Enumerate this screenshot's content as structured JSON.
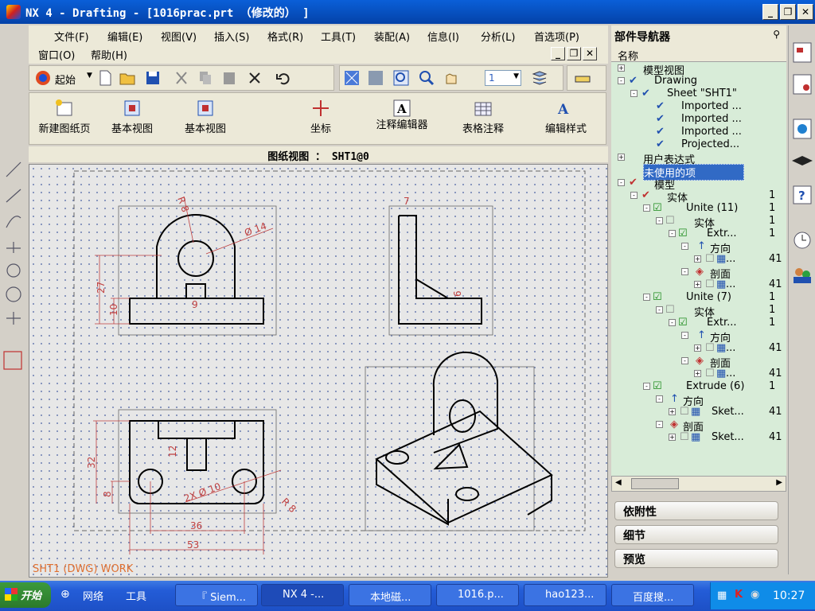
{
  "window": {
    "title": "NX 4 - Drafting - [1016prac.prt （修改的） ]"
  },
  "menubar": {
    "row1": [
      "文件(F)",
      "编辑(E)",
      "视图(V)",
      "插入(S)",
      "格式(R)",
      "工具(T)",
      "装配(A)",
      "信息(I)",
      "分析(L)",
      "首选项(P)"
    ],
    "row2": [
      "窗口(O)",
      "帮助(H)"
    ]
  },
  "toolbar": {
    "start_label": "起始",
    "layer_value": "1"
  },
  "drafting_toolbar": {
    "buttons": [
      "新建图纸页",
      "基本视图",
      "基本视图",
      "坐标",
      "注释编辑器",
      "表格注释",
      "编辑样式"
    ]
  },
  "canvas": {
    "view_label": "图纸视图 ： SHT1@0",
    "status": "SHT1 (DWG) WORK",
    "dims": {
      "r8": "R 8",
      "phi14": "Ø 14",
      "d27": "27",
      "d10": "10",
      "d9": "9",
      "d7": "7",
      "d6": "6",
      "d32": "32",
      "d8": "8",
      "d12": "12",
      "phi10": "2X Ø 10",
      "r8b": "R 8",
      "d36": "36",
      "d53": "53"
    }
  },
  "navigator": {
    "title": "部件导航器",
    "column_name": "名称",
    "tree": [
      {
        "label": "模型视图",
        "val": ""
      },
      {
        "label": "Drawing",
        "val": ""
      },
      {
        "label": "Sheet \"SHT1\"",
        "val": ""
      },
      {
        "label": "Imported ...",
        "val": ""
      },
      {
        "label": "Imported ...",
        "val": ""
      },
      {
        "label": "Imported ...",
        "val": ""
      },
      {
        "label": "Projected...",
        "val": ""
      },
      {
        "label": "用户表达式",
        "val": ""
      },
      {
        "label": "未使用的项",
        "val": ""
      },
      {
        "label": "模型",
        "val": ""
      },
      {
        "label": "实体",
        "val": "1"
      },
      {
        "label": "Unite (11)",
        "val": "1"
      },
      {
        "label": "实体",
        "val": "1"
      },
      {
        "label": "Extr...",
        "val": "1"
      },
      {
        "label": "方向",
        "val": ""
      },
      {
        "label": "...",
        "val": "41"
      },
      {
        "label": "剖面",
        "val": ""
      },
      {
        "label": "...",
        "val": "41"
      },
      {
        "label": "Unite (7)",
        "val": "1"
      },
      {
        "label": "实体",
        "val": "1"
      },
      {
        "label": "Extr...",
        "val": "1"
      },
      {
        "label": "方向",
        "val": ""
      },
      {
        "label": "...",
        "val": "41"
      },
      {
        "label": "剖面",
        "val": ""
      },
      {
        "label": "...",
        "val": "41"
      },
      {
        "label": "Extrude (6)",
        "val": "1"
      },
      {
        "label": "方向",
        "val": ""
      },
      {
        "label": "Sket...",
        "val": "41"
      },
      {
        "label": "剖面",
        "val": ""
      },
      {
        "label": "Sket...",
        "val": "41"
      }
    ],
    "sections": [
      "依附性",
      "细节",
      "预览"
    ]
  },
  "taskbar": {
    "start": "开始",
    "quick": [
      "网络",
      "工具"
    ],
    "tasks": [
      "『 Siem...",
      "NX 4 -...",
      "本地磁...",
      "1016.p...",
      "hao123...",
      "百度搜..."
    ],
    "clock": "10:27"
  },
  "colors": {
    "title": "#0a5fd8",
    "nav_bg": "#d8ecd8",
    "selected": "#316ac5",
    "dim": "#c04040"
  }
}
